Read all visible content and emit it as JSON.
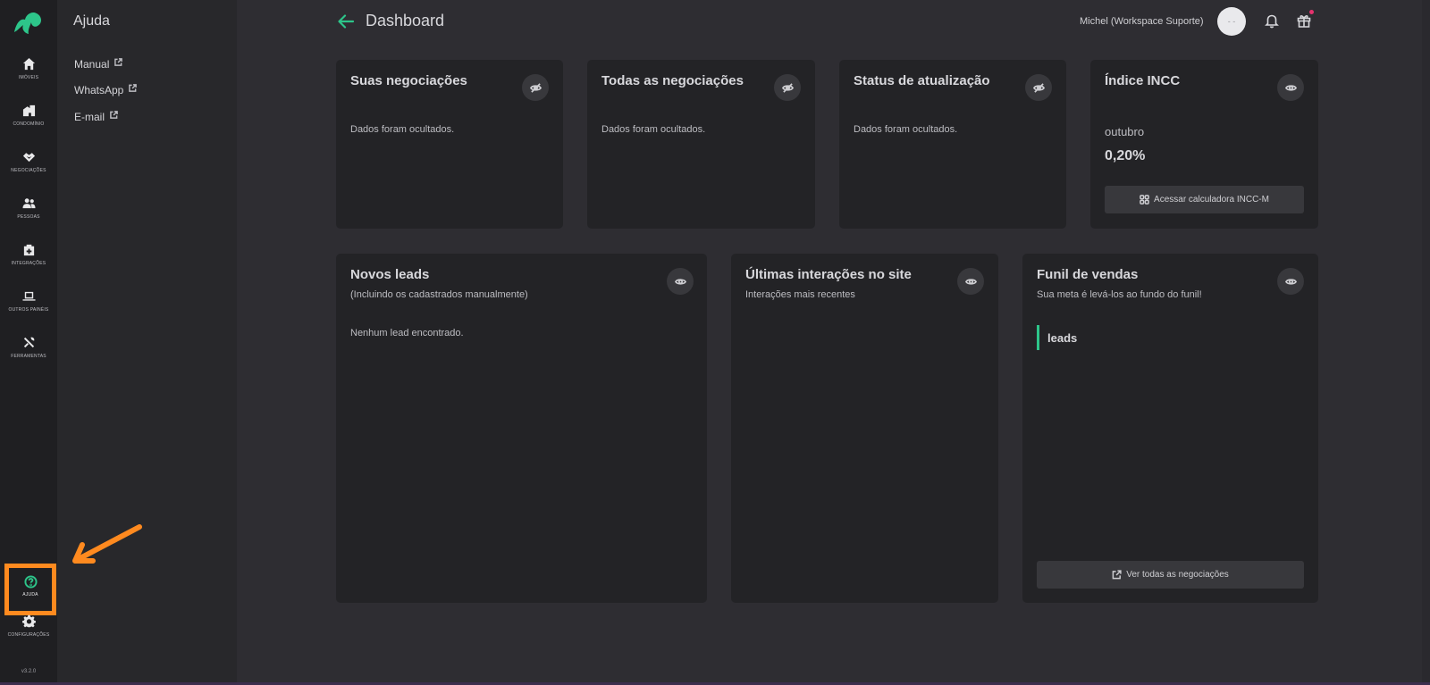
{
  "rail": {
    "items": [
      {
        "label": "IMÓVEIS",
        "icon": "home-icon"
      },
      {
        "label": "CONDOMÍNIO",
        "icon": "building-icon"
      },
      {
        "label": "NEGOCIAÇÕES",
        "icon": "handshake-icon"
      },
      {
        "label": "PESSOAS",
        "icon": "people-icon"
      },
      {
        "label": "INTEGRAÇÕES",
        "icon": "integration-icon"
      },
      {
        "label": "OUTROS PAINÉIS",
        "icon": "laptop-icon"
      },
      {
        "label": "FERRAMENTAS",
        "icon": "tools-icon"
      }
    ],
    "help": {
      "label": "AJUDA",
      "icon": "help-circle-icon"
    },
    "settings": {
      "label": "CONFIGURAÇÕES",
      "icon": "gear-icon"
    },
    "version": "v3.2.0"
  },
  "help_panel": {
    "title": "Ajuda",
    "links": [
      "Manual",
      "WhatsApp",
      "E-mail"
    ]
  },
  "header": {
    "title": "Dashboard",
    "user": "Michel (Workspace Suporte)",
    "avatar_text": "- -"
  },
  "cards": {
    "suas": {
      "title": "Suas negociações",
      "body": "Dados foram ocultados."
    },
    "todas": {
      "title": "Todas as negociações",
      "body": "Dados foram ocultados."
    },
    "status": {
      "title": "Status de atualização",
      "body": "Dados foram ocultados."
    },
    "incc": {
      "title": "Índice INCC",
      "month": "outubro",
      "value": "0,20%",
      "button": "Acessar calculadora INCC-M"
    },
    "leads": {
      "title": "Novos leads",
      "subtitle": "(Incluindo os cadastrados manualmente)",
      "body": "Nenhum lead encontrado."
    },
    "interacoes": {
      "title": "Últimas interações no site",
      "subtitle": "Interações mais recentes"
    },
    "funil": {
      "title": "Funil de vendas",
      "subtitle": "Sua meta é levá-los ao fundo do funil!",
      "stage": "leads",
      "button": "Ver todas as negociações"
    }
  },
  "colors": {
    "accent": "#2dc58a",
    "annotation": "#ff8a1f",
    "notification_dot": "#e6326e"
  }
}
